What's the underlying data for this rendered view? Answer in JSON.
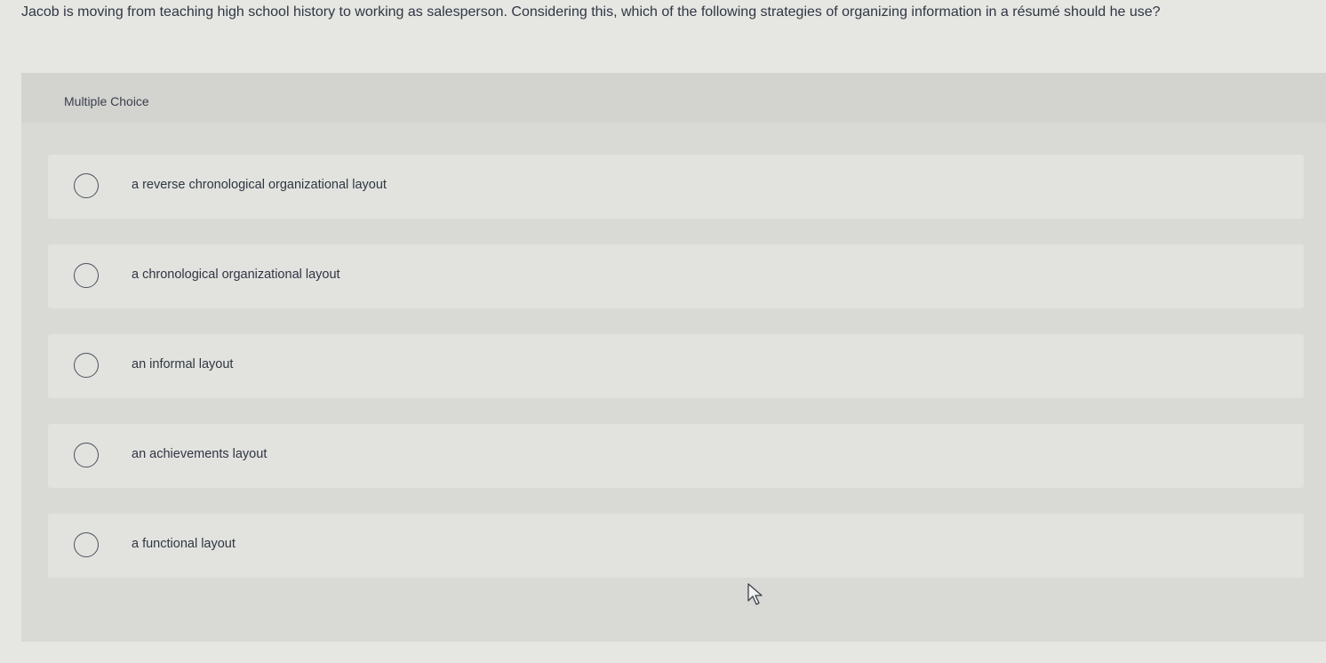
{
  "question": {
    "text": "Jacob is moving from teaching high school history to working as salesperson. Considering this, which of the following strategies of organizing information in a résumé should he use?"
  },
  "panel": {
    "label": "Multiple Choice",
    "options": [
      {
        "label": "a reverse chronological organizational layout"
      },
      {
        "label": "a chronological organizational layout"
      },
      {
        "label": "an informal layout"
      },
      {
        "label": "an achievements layout"
      },
      {
        "label": "a functional layout"
      }
    ]
  },
  "cursor": {
    "icon": "mouse-pointer-icon"
  }
}
